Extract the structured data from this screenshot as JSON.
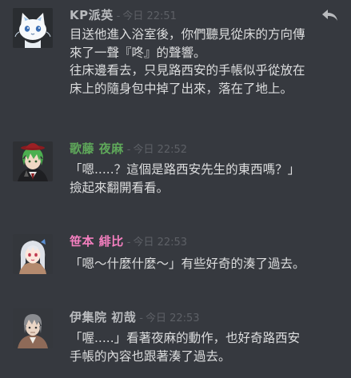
{
  "messages": [
    {
      "author": "KP派英",
      "author_color": "#b9bbbe",
      "separator": "-",
      "timestamp": "今日 22:51",
      "avatar": "white-cat-avatar",
      "lines": [
        "目送他進入浴室後，你們聽見從床的方向傳",
        "來了一聲『咚』的聲響。",
        "往床邊看去，只見路西安的手帳似乎從放在",
        "床上的隨身包中掉了出來，落在了地上。"
      ]
    },
    {
      "author": "歌藤 夜麻",
      "author_color": "#5fa85a",
      "separator": "-",
      "timestamp": "今日 22:52",
      "avatar": "green-hair-character-avatar",
      "lines": [
        "「嗯.....？這個是路西安先生的東西嗎？」",
        "撿起來翻開看看。"
      ]
    },
    {
      "author": "笹本 緋比",
      "author_color": "#f47fbf",
      "separator": "-",
      "timestamp": "今日 22:53",
      "avatar": "silver-hair-girl-avatar",
      "lines": [
        "「嗯～什麼什麼～」有些好奇的湊了過去。"
      ]
    },
    {
      "author": "伊集院 初哉",
      "author_color": "#b9bbbe",
      "separator": "-",
      "timestamp": "今日 22:53",
      "avatar": "gray-hair-man-avatar",
      "lines": [
        "「喔.....」看著夜麻的動作，也好奇路西安",
        "手帳的內容也跟著湊了過去。"
      ]
    }
  ],
  "actions": {
    "reply_icon": "reply-arrow-icon"
  },
  "colors": {
    "background": "#36393f",
    "text": "#dcddde",
    "timestamp": "#5d6066"
  }
}
